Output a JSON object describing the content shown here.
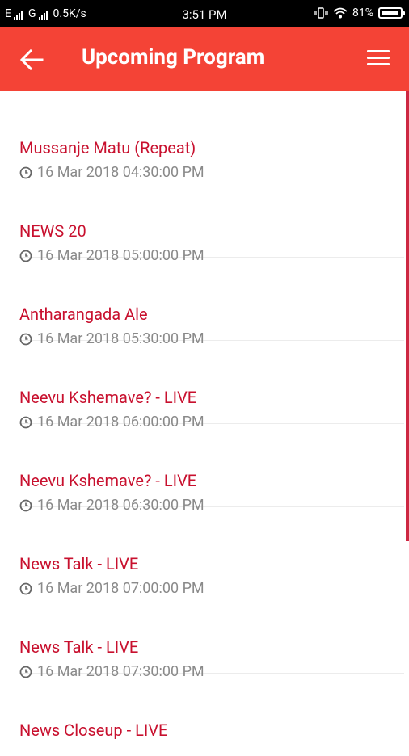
{
  "status_bar": {
    "network_left": "E",
    "network_right": "G",
    "speed": "0.5K/s",
    "time": "3:51 PM",
    "battery": "81%"
  },
  "app_bar": {
    "title": "Upcoming Program",
    "back_icon": "arrow-back-icon",
    "menu_icon": "hamburger-menu-icon",
    "bg_color": "#f44336"
  },
  "programs": [
    {
      "title": "Mussanje Matu (Repeat)",
      "time": "16 Mar 2018 04:30:00 PM"
    },
    {
      "title": "NEWS 20",
      "time": "16 Mar 2018 05:00:00 PM"
    },
    {
      "title": "Antharangada Ale",
      "time": "16 Mar 2018 05:30:00 PM"
    },
    {
      "title": "Neevu Kshemave? - LIVE",
      "time": "16 Mar 2018 06:00:00 PM"
    },
    {
      "title": "Neevu Kshemave? - LIVE",
      "time": "16 Mar 2018 06:30:00 PM"
    },
    {
      "title": "News Talk - LIVE",
      "time": "16 Mar 2018 07:00:00 PM"
    },
    {
      "title": "News Talk - LIVE",
      "time": "16 Mar 2018 07:30:00 PM"
    },
    {
      "title": "News Closeup - LIVE",
      "time": ""
    }
  ],
  "colors": {
    "accent": "#f44336",
    "title_text": "#c8102e",
    "time_text": "#8a8a8a"
  }
}
